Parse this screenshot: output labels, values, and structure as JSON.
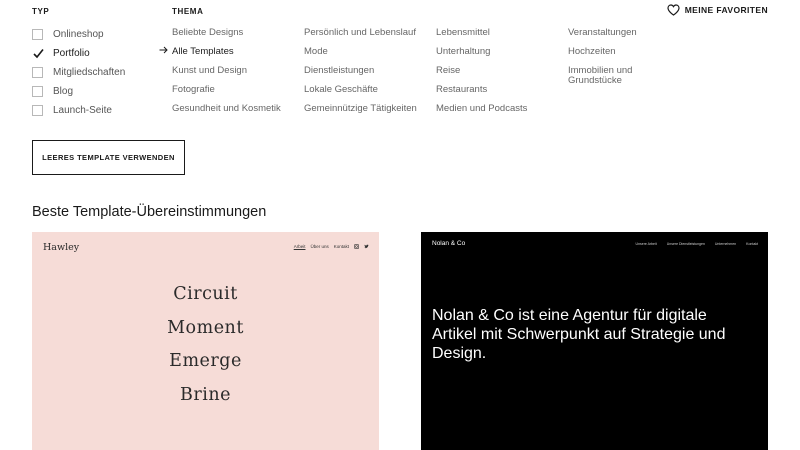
{
  "filters": {
    "typ_label": "TYP",
    "thema_label": "THEMA",
    "typ_items": [
      {
        "label": "Onlineshop",
        "checked": false
      },
      {
        "label": "Portfolio",
        "checked": true
      },
      {
        "label": "Mitgliedschaften",
        "checked": false
      },
      {
        "label": "Blog",
        "checked": false
      },
      {
        "label": "Launch-Seite",
        "checked": false
      }
    ],
    "thema_columns": [
      [
        "Beliebte Designs",
        "Alle Templates",
        "Kunst und Design",
        "Fotografie",
        "Gesundheit und Kosmetik"
      ],
      [
        "Persönlich und Lebenslauf",
        "Mode",
        "Dienstleistungen",
        "Lokale Geschäfte",
        "Gemeinnützige Tätigkeiten"
      ],
      [
        "Lebensmittel",
        "Unterhaltung",
        "Reise",
        "Restaurants",
        "Medien und Podcasts"
      ],
      [
        "Veranstaltungen",
        "Hochzeiten",
        "Immobilien und Grundstücke"
      ]
    ],
    "active_thema": "Alle Templates",
    "favorites_label": "MEINE FAVORITEN",
    "empty_template_button": "LEERES TEMPLATE VERWENDEN"
  },
  "matches": {
    "title": "Beste Template-Übereinstimmungen",
    "hawley": {
      "logo": "Hawley",
      "nav": [
        "Arbeit",
        "Über uns",
        "Kontakt"
      ],
      "words": [
        "Circuit",
        "Moment",
        "Emerge",
        "Brine"
      ],
      "bg_color": "#f6dcd7"
    },
    "nolan": {
      "logo": "Nolan & Co",
      "nav": [
        "Unsere Arbeit",
        "Unsere Dienstleistungen",
        "Unternehmen",
        "Kontakt"
      ],
      "headline": "Nolan & Co ist eine Agentur für digitale Artikel mit Schwerpunkt auf Strategie und Design.",
      "bg_color": "#000000"
    }
  }
}
